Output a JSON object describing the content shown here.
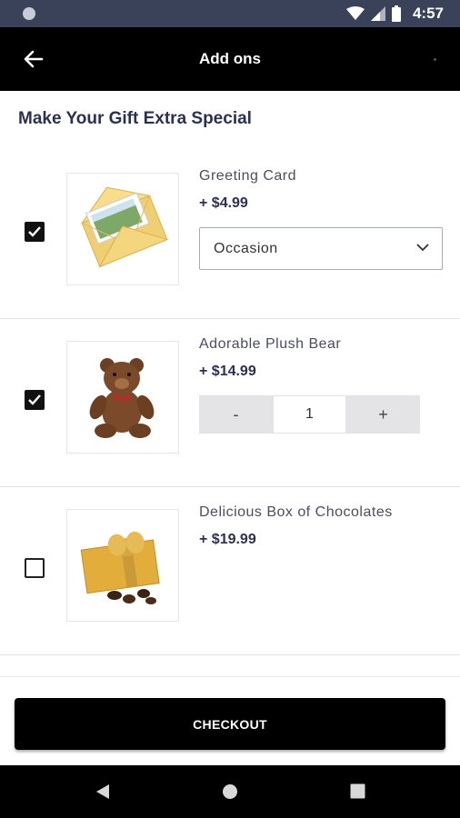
{
  "status_bar": {
    "time": "4:57"
  },
  "header": {
    "title": "Add ons"
  },
  "section": {
    "title": "Make Your Gift Extra Special"
  },
  "addons": [
    {
      "name": "Greeting Card",
      "price": "+ $4.99",
      "checked": true,
      "select_value": "Occasion"
    },
    {
      "name": "Adorable Plush Bear",
      "price": "+ $14.99",
      "checked": true,
      "decrement_label": "-",
      "quantity": "1",
      "increment_label": "+"
    },
    {
      "name": "Delicious Box of Chocolates",
      "price": "+ $19.99",
      "checked": false
    }
  ],
  "checkout": {
    "label": "CHECKOUT"
  },
  "colors": {
    "app_bar": "#000000",
    "status_bar": "#3a4259",
    "accent_text": "#2b3152"
  },
  "icons": [
    "back-arrow-icon",
    "checkmark-icon",
    "chevron-down-icon",
    "wifi-icon",
    "signal-icon",
    "battery-icon",
    "nav-back-icon",
    "nav-home-icon",
    "nav-recents-icon"
  ]
}
